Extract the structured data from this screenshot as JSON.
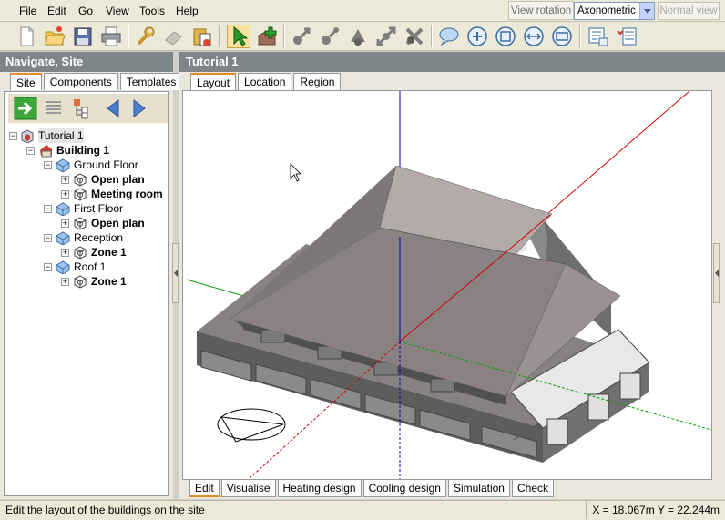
{
  "menu": [
    "File",
    "Edit",
    "Go",
    "View",
    "Tools",
    "Help"
  ],
  "view_rotation": {
    "label": "View rotation",
    "selected": "Axonometric",
    "normal_view_label": "Normal view"
  },
  "toolbar_icons": [
    "new-file-icon",
    "open-folder-icon",
    "save-icon",
    "print-icon",
    "wrench-icon",
    "eraser-icon",
    "paste-icon",
    "select-arrow-icon",
    "add-block-icon",
    "move-icon",
    "rotate-icon",
    "stretch-icon",
    "resize-icon",
    "delete-icon",
    "speech-icon",
    "zoom-in-icon",
    "zoom-extents-icon",
    "pan-icon",
    "zoom-window-icon",
    "properties-icon",
    "settings-icon"
  ],
  "left_panel": {
    "title": "Navigate, Site",
    "tabs": [
      "Site",
      "Components",
      "Templates"
    ],
    "tree": [
      {
        "label": "Tutorial 1",
        "level": 0,
        "type": "site",
        "bold": false
      },
      {
        "label": "Building 1",
        "level": 1,
        "type": "building",
        "bold": true
      },
      {
        "label": "Ground Floor",
        "level": 2,
        "type": "block",
        "bold": false
      },
      {
        "label": "Open plan",
        "level": 3,
        "type": "zone",
        "bold": true
      },
      {
        "label": "Meeting room",
        "level": 3,
        "type": "zone",
        "bold": true
      },
      {
        "label": "First Floor",
        "level": 2,
        "type": "block",
        "bold": false
      },
      {
        "label": "Open plan",
        "level": 3,
        "type": "zone",
        "bold": true
      },
      {
        "label": "Reception",
        "level": 2,
        "type": "block",
        "bold": false
      },
      {
        "label": "Zone 1",
        "level": 3,
        "type": "zone",
        "bold": true
      },
      {
        "label": "Roof 1",
        "level": 2,
        "type": "block",
        "bold": false
      },
      {
        "label": "Zone 1",
        "level": 3,
        "type": "zone",
        "bold": true
      }
    ]
  },
  "right_panel": {
    "title": "Tutorial 1",
    "top_tabs": [
      "Layout",
      "Location",
      "Region"
    ],
    "bottom_tabs": [
      "Edit",
      "Visualise",
      "Heating design",
      "Cooling design",
      "Simulation",
      "Check"
    ]
  },
  "status": {
    "message": "Edit the layout of the buildings on the site",
    "coords": "X = 18.067m  Y = 22.244m"
  },
  "colors": {
    "title_bar": "#7e8588",
    "tab_accent": "#e68b2c",
    "axis_x": "#d00000",
    "axis_y": "#00a000",
    "axis_z": "#0000c0"
  }
}
